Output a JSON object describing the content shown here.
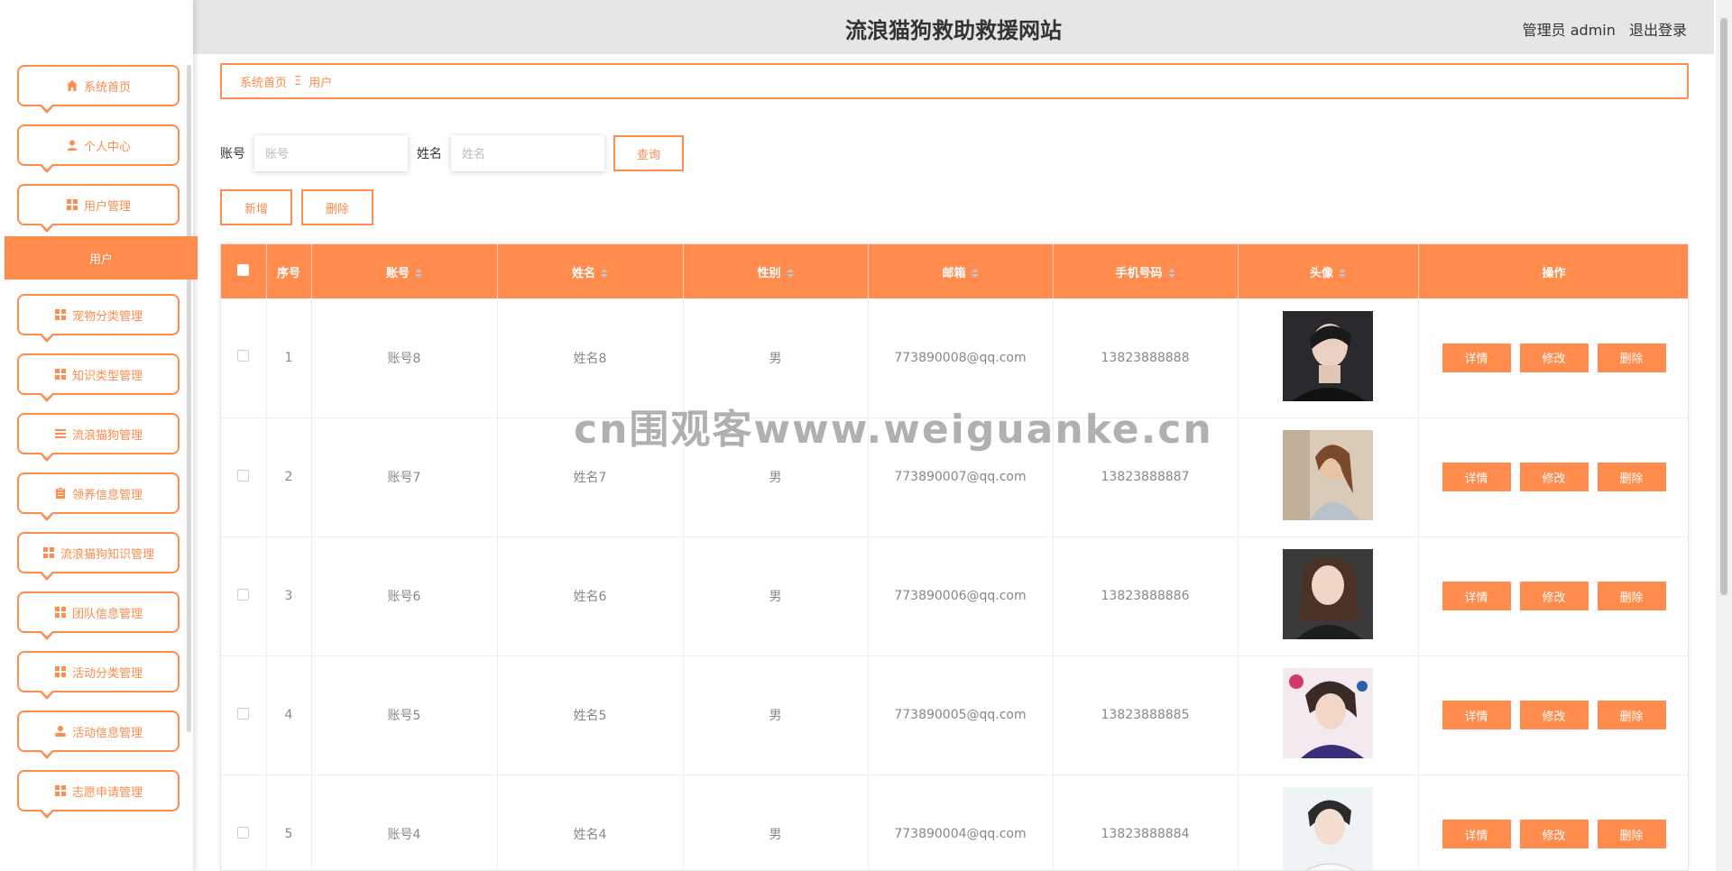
{
  "header": {
    "title": "流浪猫狗救助救援网站",
    "role": "管理员 admin",
    "logout": "退出登录"
  },
  "sidebar": {
    "items": [
      {
        "label": "系统首页",
        "icon": "home-icon"
      },
      {
        "label": "个人中心",
        "icon": "user-icon"
      },
      {
        "label": "用户管理",
        "icon": "grid-icon"
      },
      {
        "label": "宠物分类管理",
        "icon": "grid-icon"
      },
      {
        "label": "知识类型管理",
        "icon": "grid-icon"
      },
      {
        "label": "流浪猫狗管理",
        "icon": "list-icon"
      },
      {
        "label": "领养信息管理",
        "icon": "clipboard-icon"
      },
      {
        "label": "流浪猫狗知识管理",
        "icon": "grid-icon"
      },
      {
        "label": "团队信息管理",
        "icon": "grid-icon"
      },
      {
        "label": "活动分类管理",
        "icon": "grid-icon"
      },
      {
        "label": "活动信息管理",
        "icon": "person-icon"
      },
      {
        "label": "志愿申请管理",
        "icon": "grid-icon"
      }
    ],
    "submenu_active": "用户"
  },
  "breadcrumb": {
    "home": "系统首页",
    "sep": "Ξ",
    "current": "用户"
  },
  "search": {
    "account_label": "账号",
    "account_placeholder": "账号",
    "name_label": "姓名",
    "name_placeholder": "姓名",
    "query_button": "查询"
  },
  "actions": {
    "add": "新增",
    "delete": "删除"
  },
  "table": {
    "headers": [
      "序号",
      "账号",
      "姓名",
      "性别",
      "邮箱",
      "手机号码",
      "头像",
      "操作"
    ],
    "op_labels": {
      "detail": "详情",
      "edit": "修改",
      "delete": "删除"
    },
    "rows": [
      {
        "index": "1",
        "account": "账号8",
        "name": "姓名8",
        "gender": "男",
        "email": "773890008@qq.com",
        "phone": "13823888888"
      },
      {
        "index": "2",
        "account": "账号7",
        "name": "姓名7",
        "gender": "男",
        "email": "773890007@qq.com",
        "phone": "13823888887"
      },
      {
        "index": "3",
        "account": "账号6",
        "name": "姓名6",
        "gender": "男",
        "email": "773890006@qq.com",
        "phone": "13823888886"
      },
      {
        "index": "4",
        "account": "账号5",
        "name": "姓名5",
        "gender": "男",
        "email": "773890005@qq.com",
        "phone": "13823888885"
      },
      {
        "index": "5",
        "account": "账号4",
        "name": "姓名4",
        "gender": "男",
        "email": "773890004@qq.com",
        "phone": "13823888884"
      }
    ]
  },
  "watermark": "cn围观客www.weiguanke.cn",
  "colors": {
    "accent": "#ff8b4c",
    "header_bg": "#e6e6e6"
  }
}
